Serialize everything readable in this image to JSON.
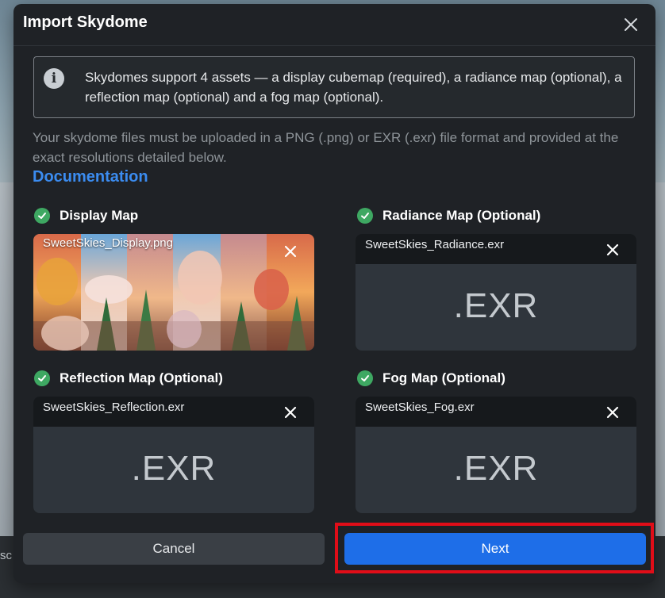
{
  "dialog": {
    "title": "Import Skydome",
    "close_icon": "close-icon"
  },
  "info": {
    "icon": "info-icon",
    "text": "Skydomes support 4 assets — a display cubemap (required), a radiance map (optional), a reflection map (optional) and a fog map (optional)."
  },
  "note": "Your skydome files must be uploaded in a PNG (.png) or EXR (.exr) file format and provided at the exact resolutions detailed below.",
  "documentation_link": "Documentation",
  "slots": {
    "display": {
      "label": "Display Map",
      "filename": "SweetSkies_Display.png"
    },
    "radiance": {
      "label": "Radiance Map (Optional)",
      "filename": "SweetSkies_Radiance.exr",
      "placeholder": ".EXR"
    },
    "reflection": {
      "label": "Reflection Map (Optional)",
      "filename": "SweetSkies_Reflection.exr",
      "placeholder": ".EXR"
    },
    "fog": {
      "label": "Fog Map (Optional)",
      "filename": "SweetSkies_Fog.exr",
      "placeholder": ".EXR"
    }
  },
  "buttons": {
    "cancel": "Cancel",
    "next": "Next"
  },
  "background_fragment": "sc",
  "colors": {
    "primary": "#1e6ee8",
    "link": "#3b8cf0",
    "success": "#3ea862",
    "highlight": "#e00d18"
  }
}
